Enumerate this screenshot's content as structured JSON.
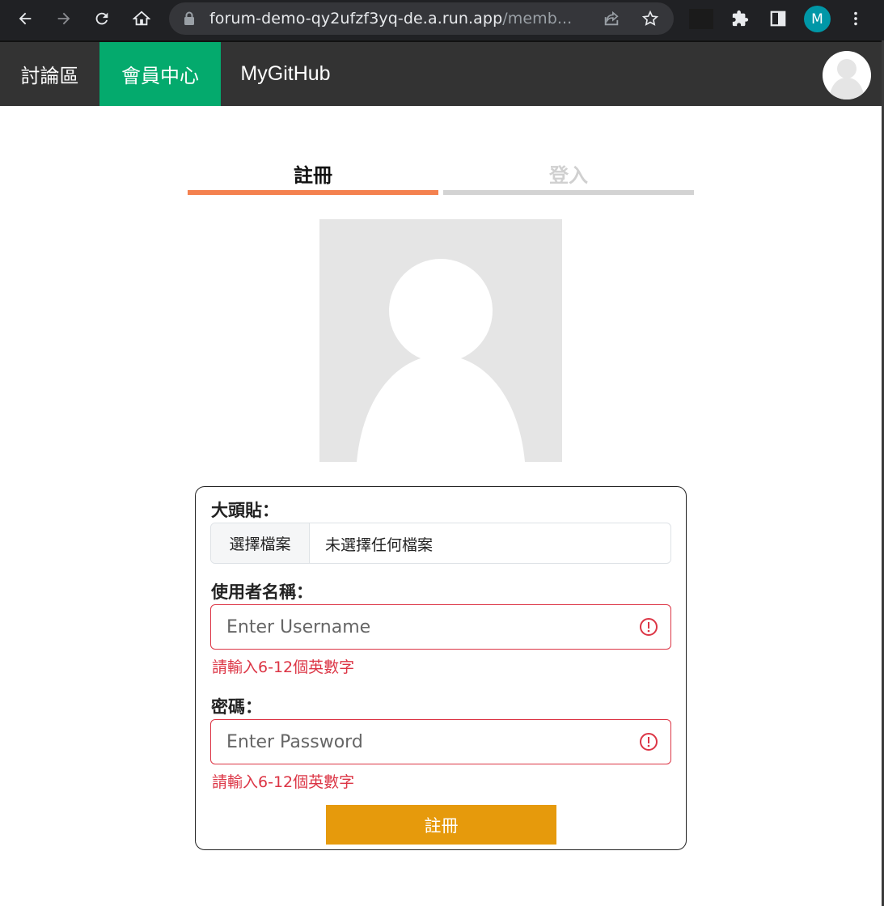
{
  "browser": {
    "url_main": "forum-demo-qy2ufzf3yq-de.a.run.app",
    "url_rest": "/memb...",
    "profile_initial": "M",
    "icons": [
      "back-arrow-icon",
      "forward-arrow-icon",
      "reload-icon",
      "home-icon",
      "lock-icon",
      "share-icon",
      "star-icon",
      "extensions-icon",
      "side-panel-icon",
      "menu-dots-icon"
    ]
  },
  "nav": {
    "forum": "討論區",
    "member": "會員中心",
    "github": "MyGitHub",
    "active_color": "#04aa6d"
  },
  "tabs": {
    "register": "註冊",
    "login": "登入",
    "active_color": "#f4814f"
  },
  "form": {
    "avatar_label": "大頭貼：",
    "file_button": "選擇檔案",
    "file_status": "未選擇任何檔案",
    "username_label": "使用者名稱：",
    "username_placeholder": "Enter Username",
    "username_error": "請輸入6-12個英數字",
    "password_label": "密碼：",
    "password_placeholder": "Enter Password",
    "password_error": "請輸入6-12個英數字",
    "submit_label": "註冊",
    "error_color": "#dc3545",
    "submit_color": "#e69a0c"
  }
}
